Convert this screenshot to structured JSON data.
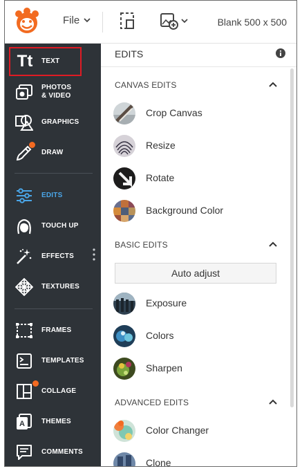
{
  "topbar": {
    "file_label": "File",
    "canvas_label": "Blank 500 x 500"
  },
  "sidebar": {
    "items": [
      {
        "label": "TEXT",
        "icon": "text-icon"
      },
      {
        "label": "PHOTOS\n& VIDEO",
        "icon": "photos-icon"
      },
      {
        "label": "GRAPHICS",
        "icon": "graphics-icon"
      },
      {
        "label": "DRAW",
        "icon": "draw-icon"
      },
      {
        "label": "EDITS",
        "icon": "sliders-icon"
      },
      {
        "label": "TOUCH UP",
        "icon": "face-icon"
      },
      {
        "label": "EFFECTS",
        "icon": "magic-wand-icon"
      },
      {
        "label": "TEXTURES",
        "icon": "textures-icon"
      },
      {
        "label": "FRAMES",
        "icon": "frame-icon"
      },
      {
        "label": "TEMPLATES",
        "icon": "templates-icon"
      },
      {
        "label": "COLLAGE",
        "icon": "collage-icon"
      },
      {
        "label": "THEMES",
        "icon": "themes-icon"
      },
      {
        "label": "COMMENTS",
        "icon": "comments-icon"
      }
    ],
    "text_icon_glyph": "Tt",
    "active": "EDITS"
  },
  "panel": {
    "title": "EDITS",
    "sections": [
      {
        "heading": "CANVAS EDITS",
        "tools": [
          "Crop Canvas",
          "Resize",
          "Rotate",
          "Background Color"
        ]
      },
      {
        "heading": "BASIC EDITS",
        "auto_button": "Auto adjust",
        "tools": [
          "Exposure",
          "Colors",
          "Sharpen"
        ]
      },
      {
        "heading": "ADVANCED EDITS",
        "tools": [
          "Color Changer",
          "Clone"
        ]
      }
    ]
  },
  "colors": {
    "sidebar_bg": "#2e3338",
    "active_accent": "#4aa6e8",
    "badge_orange": "#f36a21",
    "highlight_red": "#e01b24",
    "logo_orange": "#f26b21"
  }
}
